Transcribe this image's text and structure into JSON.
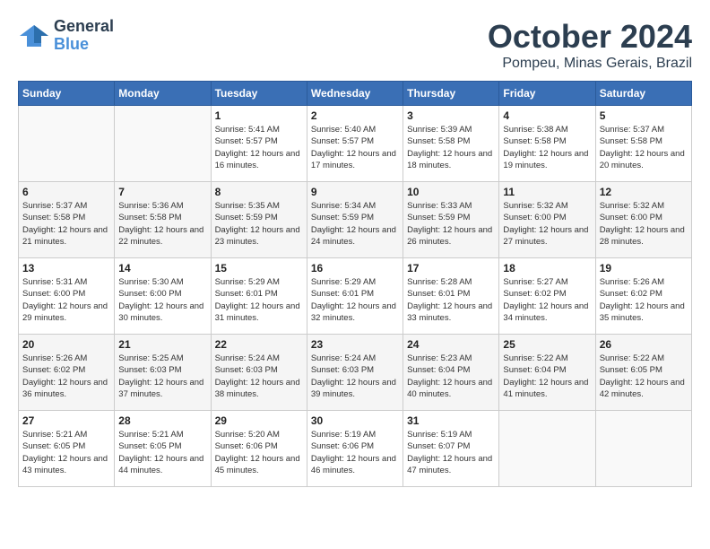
{
  "header": {
    "logo_line1": "General",
    "logo_line2": "Blue",
    "month": "October 2024",
    "location": "Pompeu, Minas Gerais, Brazil"
  },
  "weekdays": [
    "Sunday",
    "Monday",
    "Tuesday",
    "Wednesday",
    "Thursday",
    "Friday",
    "Saturday"
  ],
  "weeks": [
    [
      {
        "day": "",
        "sunrise": "",
        "sunset": "",
        "daylight": ""
      },
      {
        "day": "",
        "sunrise": "",
        "sunset": "",
        "daylight": ""
      },
      {
        "day": "1",
        "sunrise": "Sunrise: 5:41 AM",
        "sunset": "Sunset: 5:57 PM",
        "daylight": "Daylight: 12 hours and 16 minutes."
      },
      {
        "day": "2",
        "sunrise": "Sunrise: 5:40 AM",
        "sunset": "Sunset: 5:57 PM",
        "daylight": "Daylight: 12 hours and 17 minutes."
      },
      {
        "day": "3",
        "sunrise": "Sunrise: 5:39 AM",
        "sunset": "Sunset: 5:58 PM",
        "daylight": "Daylight: 12 hours and 18 minutes."
      },
      {
        "day": "4",
        "sunrise": "Sunrise: 5:38 AM",
        "sunset": "Sunset: 5:58 PM",
        "daylight": "Daylight: 12 hours and 19 minutes."
      },
      {
        "day": "5",
        "sunrise": "Sunrise: 5:37 AM",
        "sunset": "Sunset: 5:58 PM",
        "daylight": "Daylight: 12 hours and 20 minutes."
      }
    ],
    [
      {
        "day": "6",
        "sunrise": "Sunrise: 5:37 AM",
        "sunset": "Sunset: 5:58 PM",
        "daylight": "Daylight: 12 hours and 21 minutes."
      },
      {
        "day": "7",
        "sunrise": "Sunrise: 5:36 AM",
        "sunset": "Sunset: 5:58 PM",
        "daylight": "Daylight: 12 hours and 22 minutes."
      },
      {
        "day": "8",
        "sunrise": "Sunrise: 5:35 AM",
        "sunset": "Sunset: 5:59 PM",
        "daylight": "Daylight: 12 hours and 23 minutes."
      },
      {
        "day": "9",
        "sunrise": "Sunrise: 5:34 AM",
        "sunset": "Sunset: 5:59 PM",
        "daylight": "Daylight: 12 hours and 24 minutes."
      },
      {
        "day": "10",
        "sunrise": "Sunrise: 5:33 AM",
        "sunset": "Sunset: 5:59 PM",
        "daylight": "Daylight: 12 hours and 26 minutes."
      },
      {
        "day": "11",
        "sunrise": "Sunrise: 5:32 AM",
        "sunset": "Sunset: 6:00 PM",
        "daylight": "Daylight: 12 hours and 27 minutes."
      },
      {
        "day": "12",
        "sunrise": "Sunrise: 5:32 AM",
        "sunset": "Sunset: 6:00 PM",
        "daylight": "Daylight: 12 hours and 28 minutes."
      }
    ],
    [
      {
        "day": "13",
        "sunrise": "Sunrise: 5:31 AM",
        "sunset": "Sunset: 6:00 PM",
        "daylight": "Daylight: 12 hours and 29 minutes."
      },
      {
        "day": "14",
        "sunrise": "Sunrise: 5:30 AM",
        "sunset": "Sunset: 6:00 PM",
        "daylight": "Daylight: 12 hours and 30 minutes."
      },
      {
        "day": "15",
        "sunrise": "Sunrise: 5:29 AM",
        "sunset": "Sunset: 6:01 PM",
        "daylight": "Daylight: 12 hours and 31 minutes."
      },
      {
        "day": "16",
        "sunrise": "Sunrise: 5:29 AM",
        "sunset": "Sunset: 6:01 PM",
        "daylight": "Daylight: 12 hours and 32 minutes."
      },
      {
        "day": "17",
        "sunrise": "Sunrise: 5:28 AM",
        "sunset": "Sunset: 6:01 PM",
        "daylight": "Daylight: 12 hours and 33 minutes."
      },
      {
        "day": "18",
        "sunrise": "Sunrise: 5:27 AM",
        "sunset": "Sunset: 6:02 PM",
        "daylight": "Daylight: 12 hours and 34 minutes."
      },
      {
        "day": "19",
        "sunrise": "Sunrise: 5:26 AM",
        "sunset": "Sunset: 6:02 PM",
        "daylight": "Daylight: 12 hours and 35 minutes."
      }
    ],
    [
      {
        "day": "20",
        "sunrise": "Sunrise: 5:26 AM",
        "sunset": "Sunset: 6:02 PM",
        "daylight": "Daylight: 12 hours and 36 minutes."
      },
      {
        "day": "21",
        "sunrise": "Sunrise: 5:25 AM",
        "sunset": "Sunset: 6:03 PM",
        "daylight": "Daylight: 12 hours and 37 minutes."
      },
      {
        "day": "22",
        "sunrise": "Sunrise: 5:24 AM",
        "sunset": "Sunset: 6:03 PM",
        "daylight": "Daylight: 12 hours and 38 minutes."
      },
      {
        "day": "23",
        "sunrise": "Sunrise: 5:24 AM",
        "sunset": "Sunset: 6:03 PM",
        "daylight": "Daylight: 12 hours and 39 minutes."
      },
      {
        "day": "24",
        "sunrise": "Sunrise: 5:23 AM",
        "sunset": "Sunset: 6:04 PM",
        "daylight": "Daylight: 12 hours and 40 minutes."
      },
      {
        "day": "25",
        "sunrise": "Sunrise: 5:22 AM",
        "sunset": "Sunset: 6:04 PM",
        "daylight": "Daylight: 12 hours and 41 minutes."
      },
      {
        "day": "26",
        "sunrise": "Sunrise: 5:22 AM",
        "sunset": "Sunset: 6:05 PM",
        "daylight": "Daylight: 12 hours and 42 minutes."
      }
    ],
    [
      {
        "day": "27",
        "sunrise": "Sunrise: 5:21 AM",
        "sunset": "Sunset: 6:05 PM",
        "daylight": "Daylight: 12 hours and 43 minutes."
      },
      {
        "day": "28",
        "sunrise": "Sunrise: 5:21 AM",
        "sunset": "Sunset: 6:05 PM",
        "daylight": "Daylight: 12 hours and 44 minutes."
      },
      {
        "day": "29",
        "sunrise": "Sunrise: 5:20 AM",
        "sunset": "Sunset: 6:06 PM",
        "daylight": "Daylight: 12 hours and 45 minutes."
      },
      {
        "day": "30",
        "sunrise": "Sunrise: 5:19 AM",
        "sunset": "Sunset: 6:06 PM",
        "daylight": "Daylight: 12 hours and 46 minutes."
      },
      {
        "day": "31",
        "sunrise": "Sunrise: 5:19 AM",
        "sunset": "Sunset: 6:07 PM",
        "daylight": "Daylight: 12 hours and 47 minutes."
      },
      {
        "day": "",
        "sunrise": "",
        "sunset": "",
        "daylight": ""
      },
      {
        "day": "",
        "sunrise": "",
        "sunset": "",
        "daylight": ""
      }
    ]
  ]
}
